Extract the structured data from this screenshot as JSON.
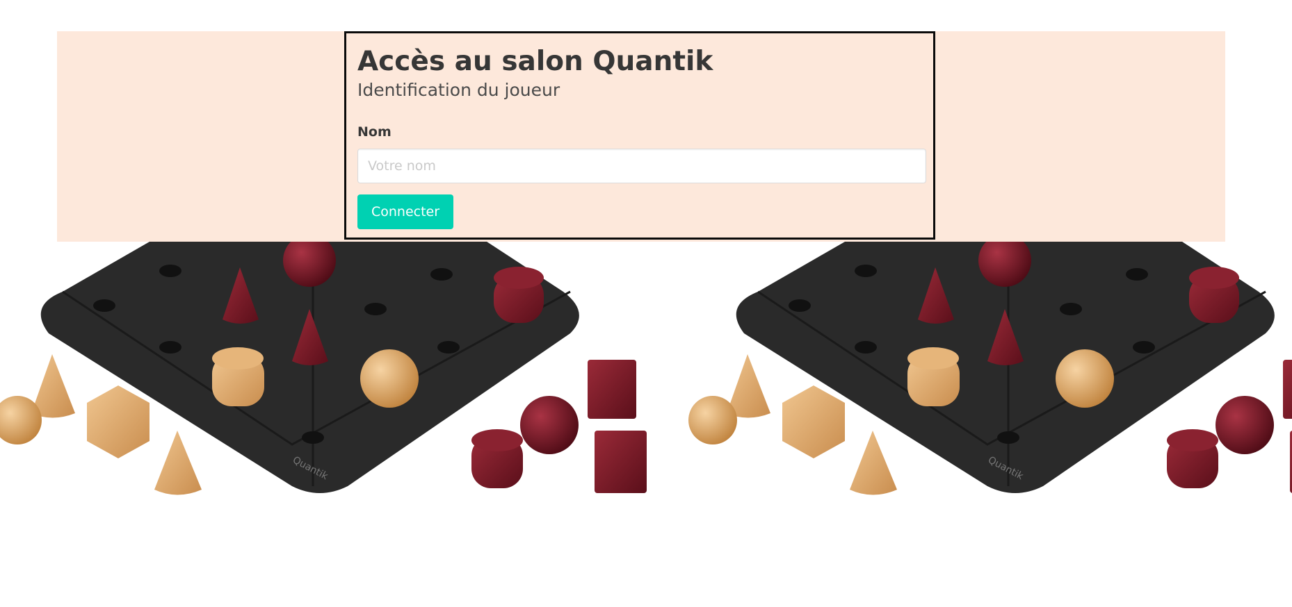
{
  "login": {
    "title": "Accès au salon Quantik",
    "subtitle": "Identification du joueur",
    "name_label": "Nom",
    "name_placeholder": "Votre nom",
    "name_value": "",
    "submit_label": "Connecter"
  },
  "colors": {
    "banner_background": "#fde8db",
    "button_background": "#00d1b2",
    "box_border": "#0a0a0a",
    "board": "#2e2e2e",
    "light_wood": "#d9a46a",
    "dark_wood": "#6e1420"
  },
  "background": {
    "image": "quantik-board-with-wooden-pieces",
    "board_brand": "Quantik"
  }
}
